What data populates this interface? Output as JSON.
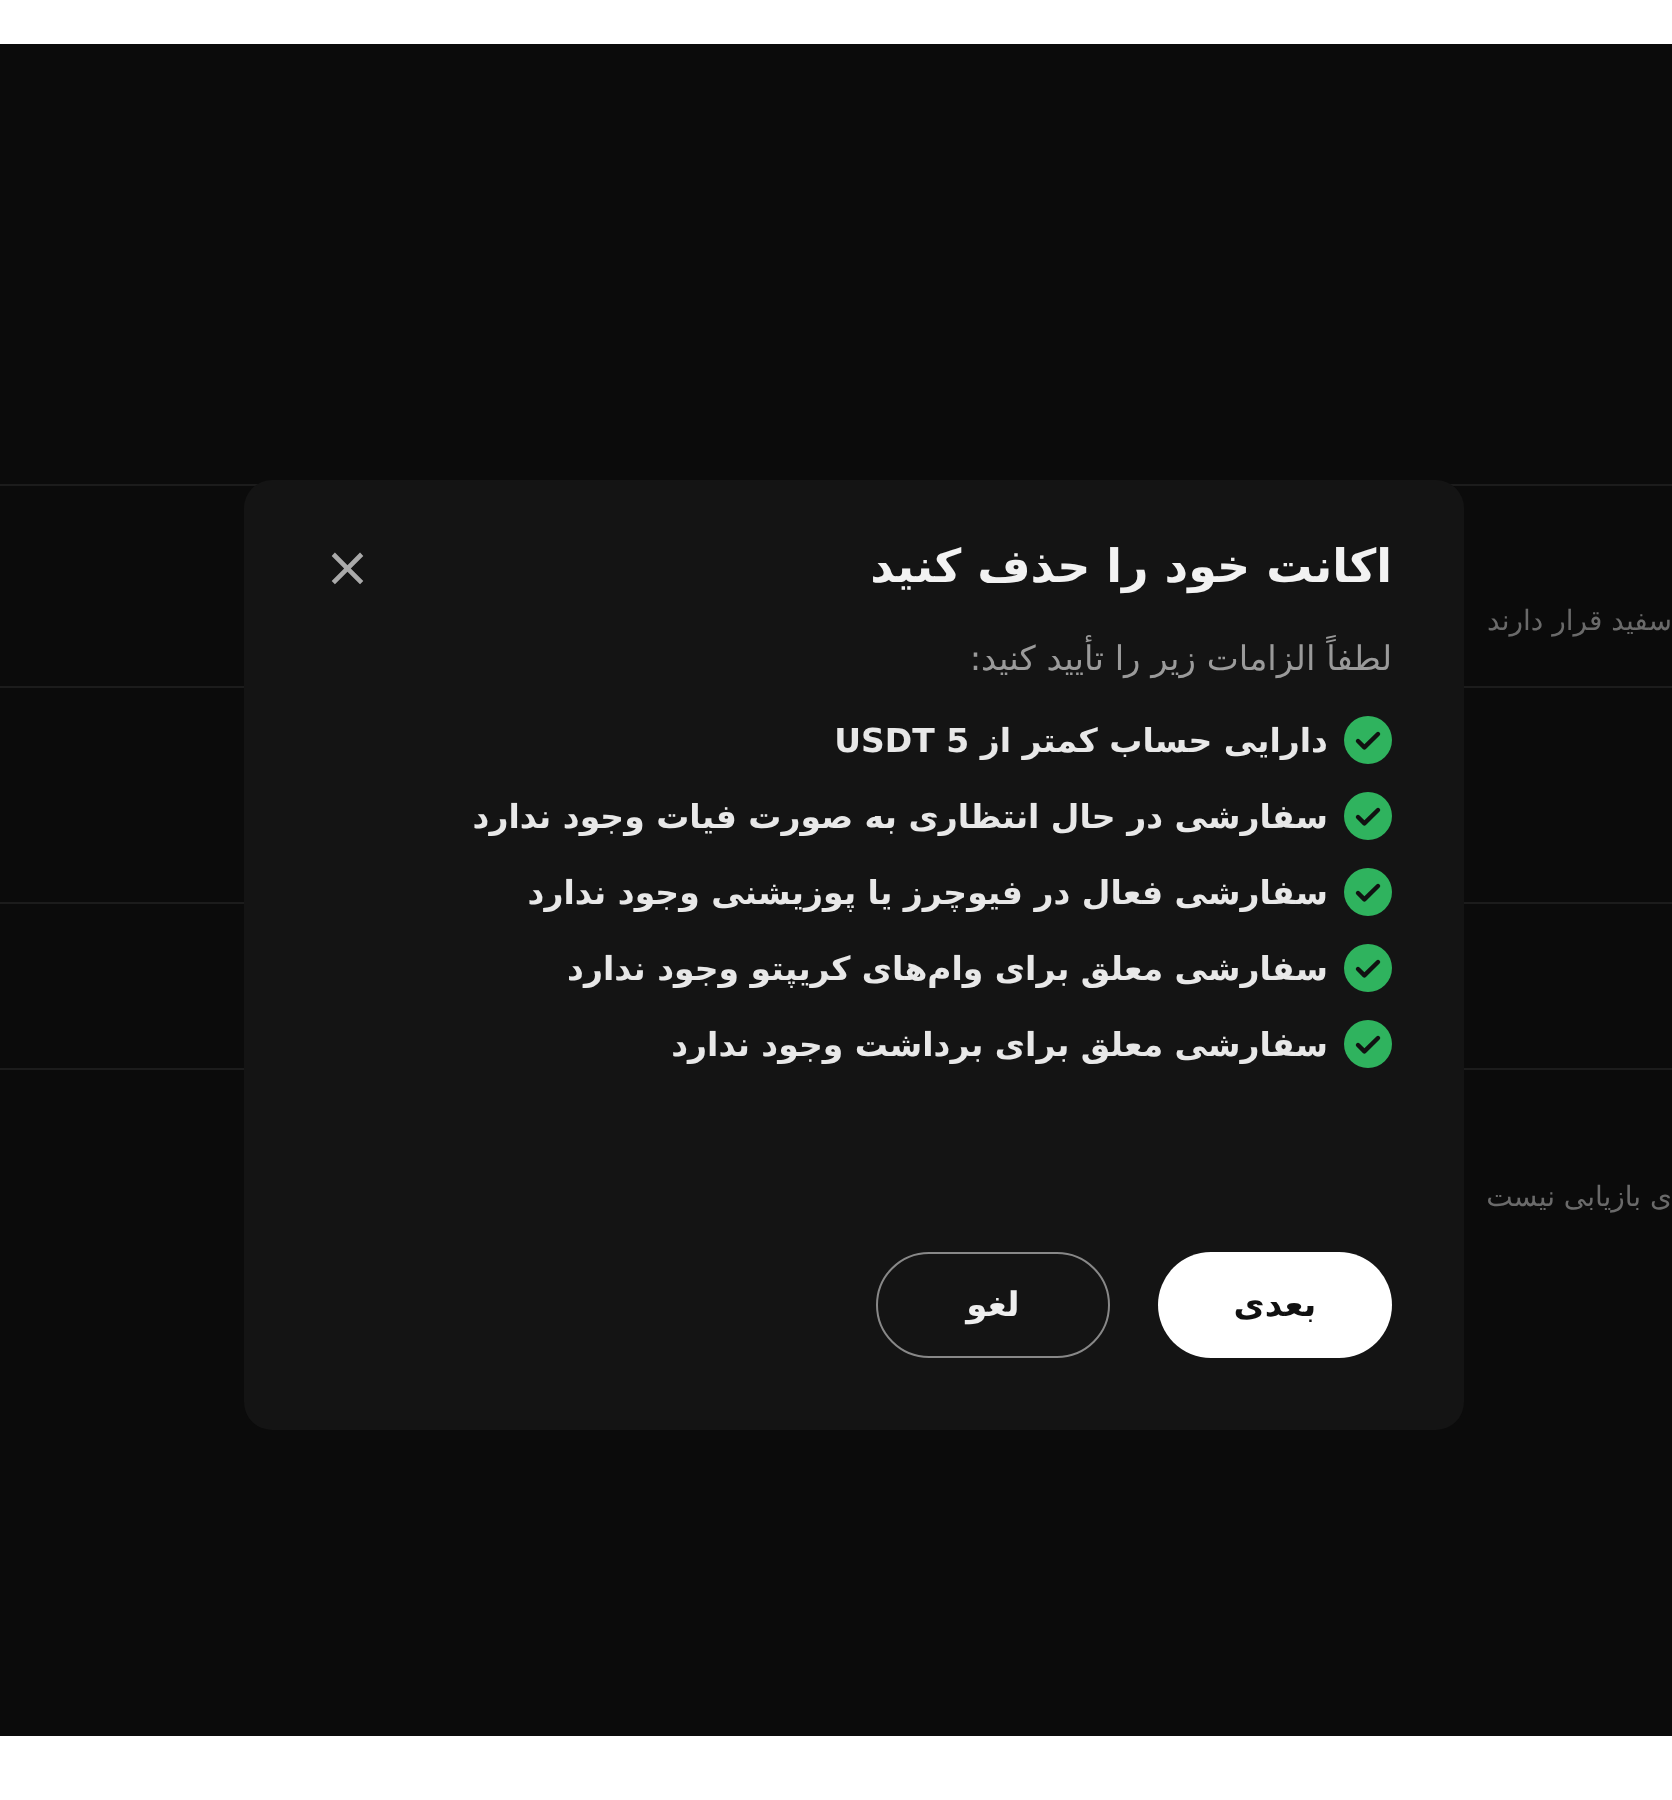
{
  "background": {
    "texts": [
      "سفید قرار دارند",
      "ی بازیابی نیست"
    ]
  },
  "dialog": {
    "title": "اکانت خود را حذف کنید",
    "close": "×",
    "subtitle": "لطفاً الزامات زیر را تأیید کنید:",
    "requirements": [
      {
        "text": "دارایی حساب کمتر از 5 USDT",
        "checked": true
      },
      {
        "text": "سفارشی در حال انتظاری به صورت فیات وجود ندارد",
        "checked": true
      },
      {
        "text": "سفارشی فعال در فیوچرز یا پوزیشنی وجود ندارد",
        "checked": true
      },
      {
        "text": "سفارشی معلق برای وام‌های کریپتو وجود ندارد",
        "checked": true
      },
      {
        "text": "سفارشی معلق برای برداشت وجود ندارد",
        "checked": true
      }
    ],
    "buttons": [
      {
        "label": "بعدی",
        "kind": "primary"
      },
      {
        "label": "لغو",
        "kind": "secondary"
      }
    ]
  }
}
